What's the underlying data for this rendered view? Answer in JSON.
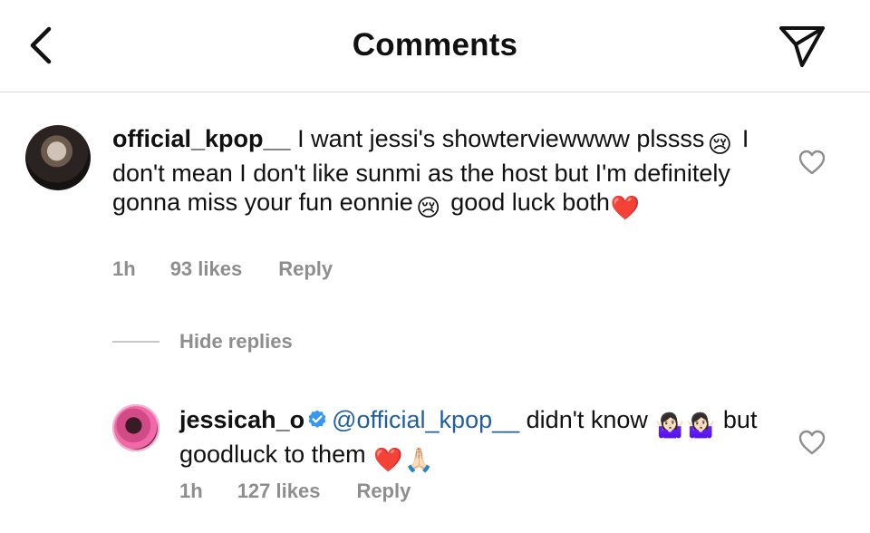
{
  "header": {
    "title": "Comments",
    "back_icon": "chevron-left-icon",
    "share_icon": "paper-plane-icon"
  },
  "comments": [
    {
      "username": "official_kpop__",
      "avatar_icon": "user-avatar",
      "text_parts": [
        " I want jessi's showterviewwww plssss",
        " I don't mean I don't like sunmi as the host but I'm definitely gonna miss your fun eonnie",
        " good luck both"
      ],
      "emojis": [
        "😢",
        "😢",
        "❤️"
      ],
      "time": "1h",
      "likes": "93 likes",
      "reply_label": "Reply",
      "like_icon": "heart-outline-icon"
    },
    {
      "username": "jessicah_o",
      "verified": true,
      "avatar_icon": "user-avatar",
      "mention": "@official_kpop__",
      "text_parts": [
        " didn't know ",
        " but goodluck to them "
      ],
      "emojis": [
        "🤷🏻‍♀️",
        "🤷🏻‍♀️",
        "❤️",
        "🙏🏻"
      ],
      "time": "1h",
      "likes": "127 likes",
      "reply_label": "Reply",
      "like_icon": "heart-outline-icon"
    }
  ],
  "replies_toggle": {
    "label": "Hide replies"
  },
  "colors": {
    "text": "#111111",
    "muted": "#8e8e8e",
    "mention": "#1f5f9f",
    "verified": "#3897f0",
    "divider": "#dbdbdb"
  }
}
